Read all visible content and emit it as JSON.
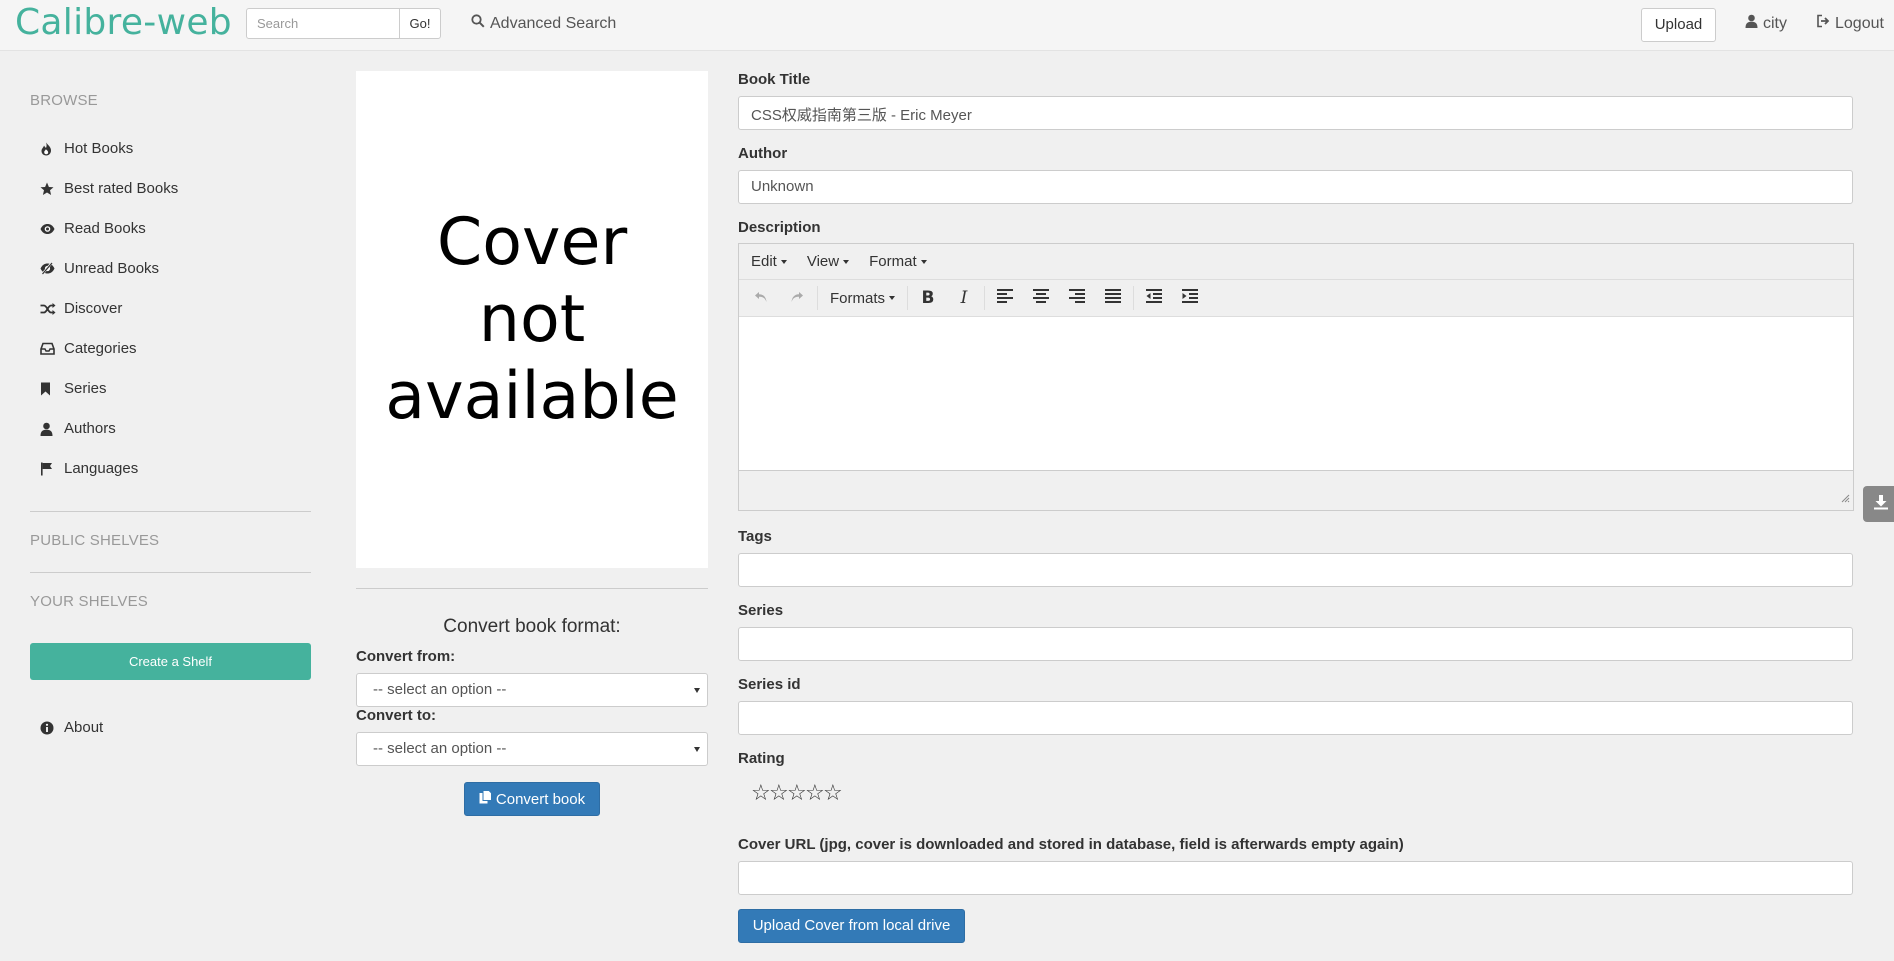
{
  "navbar": {
    "brand": "Calibre-web",
    "search_placeholder": "Search",
    "go_label": "Go!",
    "advanced_search": "Advanced Search",
    "upload_label": "Upload",
    "user_label": "city",
    "logout_label": "Logout"
  },
  "sidebar": {
    "browse_heading": "BROWSE",
    "items": [
      {
        "label": "Hot Books",
        "icon": "fire-icon"
      },
      {
        "label": "Best rated Books",
        "icon": "star-icon"
      },
      {
        "label": "Read Books",
        "icon": "eye-icon"
      },
      {
        "label": "Unread Books",
        "icon": "eye-slash-icon"
      },
      {
        "label": "Discover",
        "icon": "shuffle-icon"
      },
      {
        "label": "Categories",
        "icon": "inbox-icon"
      },
      {
        "label": "Series",
        "icon": "bookmark-icon"
      },
      {
        "label": "Authors",
        "icon": "user-icon"
      },
      {
        "label": "Languages",
        "icon": "flag-icon"
      }
    ],
    "public_shelves": "PUBLIC SHELVES",
    "your_shelves": "YOUR SHELVES",
    "create_shelf": "Create a Shelf",
    "about": "About"
  },
  "cover": {
    "line1": "Cover",
    "line2": "not",
    "line3": "available"
  },
  "convert": {
    "title": "Convert book format:",
    "from_label": "Convert from:",
    "from_value": "-- select an option --",
    "to_label": "Convert to:",
    "to_value": "-- select an option --",
    "button": "Convert book"
  },
  "form": {
    "title_label": "Book Title",
    "title_value": "CSS权威指南第三版 - Eric Meyer",
    "author_label": "Author",
    "author_value": "Unknown",
    "description_label": "Description",
    "editor": {
      "menu_edit": "Edit",
      "menu_view": "View",
      "menu_format": "Format",
      "formats": "Formats"
    },
    "tags_label": "Tags",
    "tags_value": "",
    "series_label": "Series",
    "series_value": "",
    "series_id_label": "Series id",
    "series_id_value": "",
    "rating_label": "Rating",
    "rating_value": 0,
    "rating_max": 5,
    "cover_url_label": "Cover URL (jpg, cover is downloaded and stored in database, field is afterwards empty again)",
    "cover_url_value": "",
    "upload_cover_button": "Upload Cover from local drive"
  },
  "colors": {
    "brand": "#45b29d",
    "primary": "#337ab7",
    "background": "#f0f0f0"
  }
}
